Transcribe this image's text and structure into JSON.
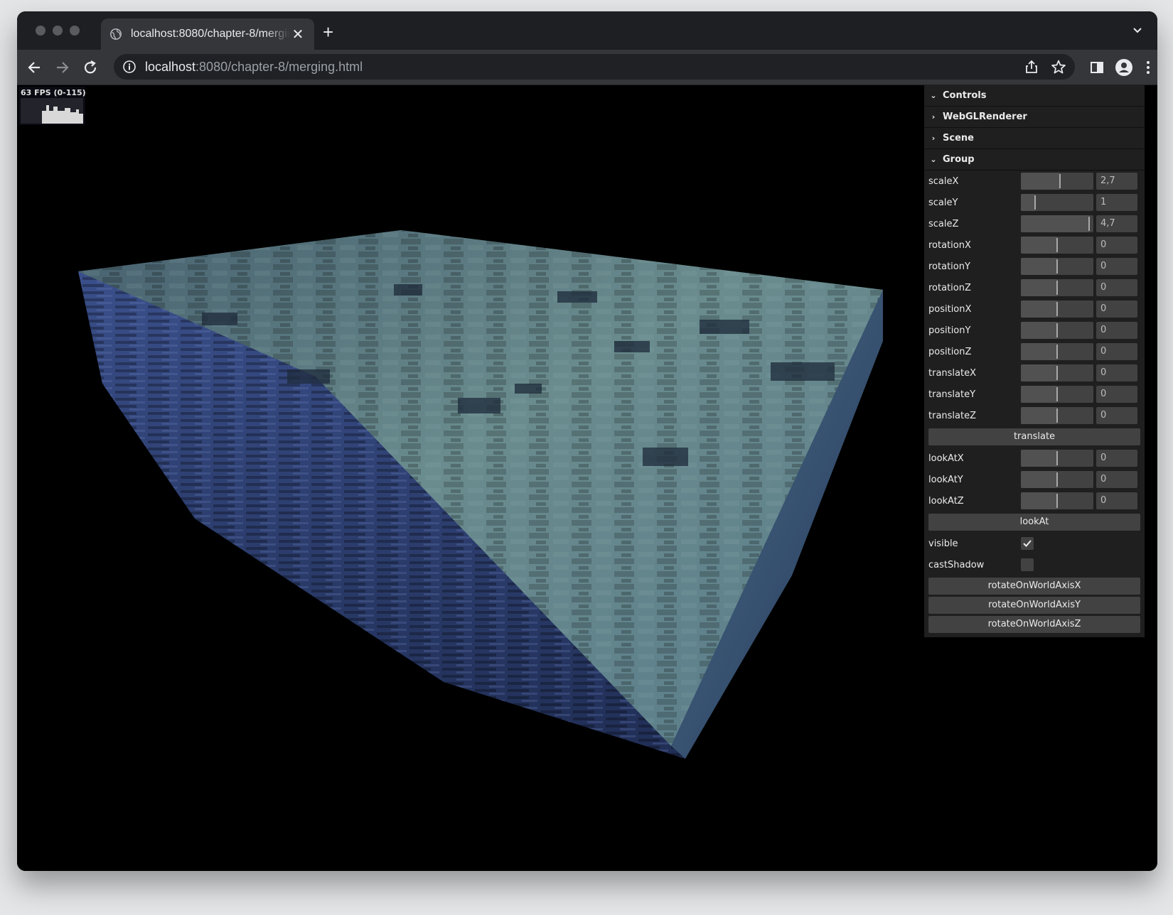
{
  "browser": {
    "tab_title": "localhost:8080/chapter-8/merging.html",
    "tab_close": "✕",
    "new_tab": "+",
    "url_host": "localhost",
    "url_rest": ":8080/chapter-8/merging.html"
  },
  "stats": {
    "fps_label": "63 FPS (0-115)"
  },
  "gui": {
    "controls": "Controls",
    "folders": {
      "renderer": "WebGLRenderer",
      "scene": "Scene",
      "group": "Group"
    },
    "params": [
      {
        "label": "scaleX",
        "value": "2,7",
        "level": 0.54
      },
      {
        "label": "scaleY",
        "value": "1",
        "level": 0.2
      },
      {
        "label": "scaleZ",
        "value": "4,7",
        "level": 0.94
      },
      {
        "label": "rotationX",
        "value": "0",
        "level": 0.5
      },
      {
        "label": "rotationY",
        "value": "0",
        "level": 0.5
      },
      {
        "label": "rotationZ",
        "value": "0",
        "level": 0.5
      },
      {
        "label": "positionX",
        "value": "0",
        "level": 0.5
      },
      {
        "label": "positionY",
        "value": "0",
        "level": 0.5
      },
      {
        "label": "positionZ",
        "value": "0",
        "level": 0.5
      },
      {
        "label": "translateX",
        "value": "0",
        "level": 0.5
      },
      {
        "label": "translateY",
        "value": "0",
        "level": 0.5
      },
      {
        "label": "translateZ",
        "value": "0",
        "level": 0.5
      }
    ],
    "translate_btn": "translate",
    "look": [
      {
        "label": "lookAtX",
        "value": "0",
        "level": 0.5
      },
      {
        "label": "lookAtY",
        "value": "0",
        "level": 0.5
      },
      {
        "label": "lookAtZ",
        "value": "0",
        "level": 0.5
      }
    ],
    "lookat_btn": "lookAt",
    "visible_label": "visible",
    "visible_checked": true,
    "castshadow_label": "castShadow",
    "castshadow_checked": false,
    "rotate_x": "rotateOnWorldAxisX",
    "rotate_y": "rotateOnWorldAxisY",
    "rotate_z": "rotateOnWorldAxisZ"
  },
  "colors": {
    "top_face": "#5f7f86",
    "side_face": "#33457e",
    "panel_bg": "#1f1f1f"
  }
}
